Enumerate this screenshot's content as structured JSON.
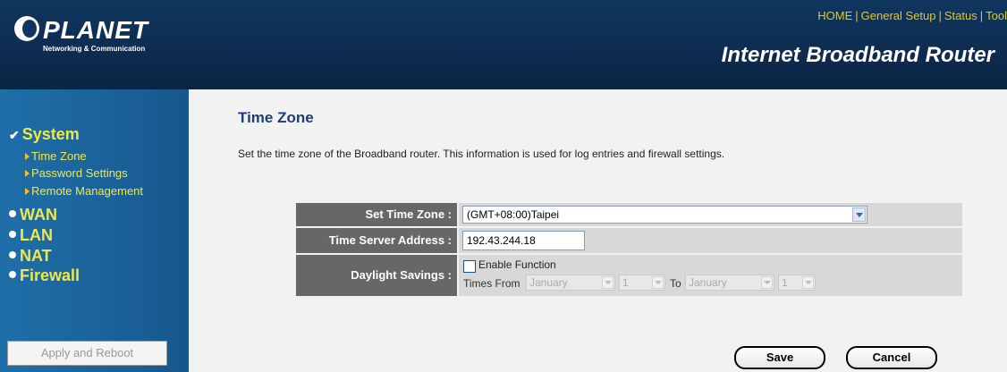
{
  "header": {
    "brand": "PLANET",
    "tagline": "Networking & Communication",
    "product_title": "Internet Broadband Router",
    "nav": [
      "HOME",
      "General Setup",
      "Status",
      "Tool"
    ]
  },
  "sidebar": {
    "sections": [
      {
        "label": "System",
        "active": true,
        "sub": [
          "Time Zone",
          "Password Settings",
          "Remote Management"
        ]
      },
      {
        "label": "WAN"
      },
      {
        "label": "LAN"
      },
      {
        "label": "NAT"
      },
      {
        "label": "Firewall"
      }
    ],
    "apply_button": "Apply and Reboot"
  },
  "main": {
    "title": "Time Zone",
    "description": "Set the time zone of the Broadband router. This information is used for log entries and firewall settings.",
    "form": {
      "time_zone_label": "Set Time Zone :",
      "time_zone_value": "(GMT+08:00)Taipei",
      "server_label": "Time Server Address :",
      "server_value": "192.43.244.18",
      "daylight_label": "Daylight Savings :",
      "enable_label": "Enable Function",
      "enable_checked": false,
      "times_from_label": "Times From",
      "from_month": "January",
      "from_day": "1",
      "to_label": "To",
      "to_month": "January",
      "to_day": "1"
    },
    "save_button": "Save",
    "cancel_button": "Cancel"
  },
  "colors": {
    "header_bg": "#0d2a4d",
    "sidebar_bg": "#1a5f96",
    "nav_text": "#f0e84a",
    "label_bg": "#676767",
    "value_bg": "#d8d8d8",
    "title_color": "#1f3f6e"
  }
}
